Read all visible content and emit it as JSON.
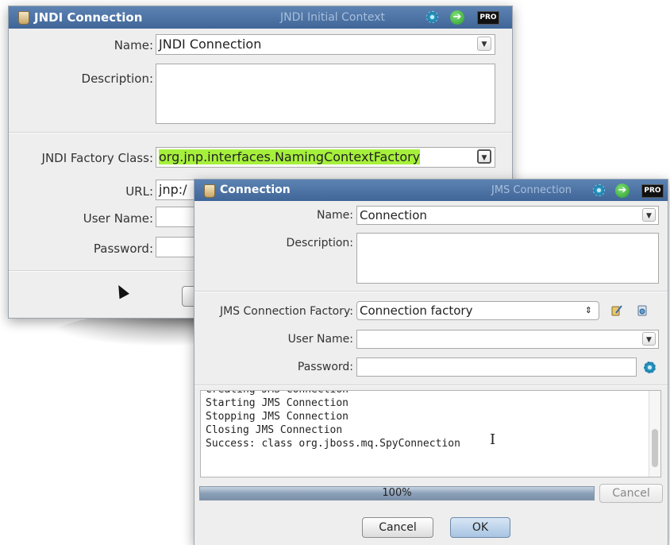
{
  "colors": {
    "titlebar": "#4a70a1",
    "highlight": "#a6f03c",
    "progress": "#8ba0b8"
  },
  "jndi_dialog": {
    "title": "JNDI Connection",
    "subtitle": "JNDI Initial Context",
    "pro_badge": "PRO",
    "name_label": "Name:",
    "name_value": "JNDI Connection",
    "description_label": "Description:",
    "description_value": "",
    "factory_label": "JNDI Factory Class:",
    "factory_value": "org.jnp.interfaces.NamingContextFactory",
    "url_label": "URL:",
    "url_value": "jnp:/",
    "username_label": "User Name:",
    "username_value": "",
    "password_label": "Password:",
    "password_value": ""
  },
  "jms_dialog": {
    "title": "Connection",
    "subtitle": "JMS Connection",
    "pro_badge": "PRO",
    "name_label": "Name:",
    "name_value": "Connection",
    "description_label": "Description:",
    "description_value": "",
    "factory_label": "JMS Connection Factory:",
    "factory_value": "Connection factory",
    "username_label": "User Name:",
    "username_value": "",
    "password_label": "Password:",
    "password_value": "",
    "log_lines": [
      "Creating JMS Connection",
      "Starting JMS Connection",
      "Stopping JMS Connection",
      "Closing JMS Connection",
      "Success: class org.jboss.mq.SpyConnection"
    ],
    "progress": {
      "label": "100%",
      "value": 1.0
    },
    "progress_cancel_label": "Cancel",
    "cancel_label": "Cancel",
    "ok_label": "OK"
  }
}
